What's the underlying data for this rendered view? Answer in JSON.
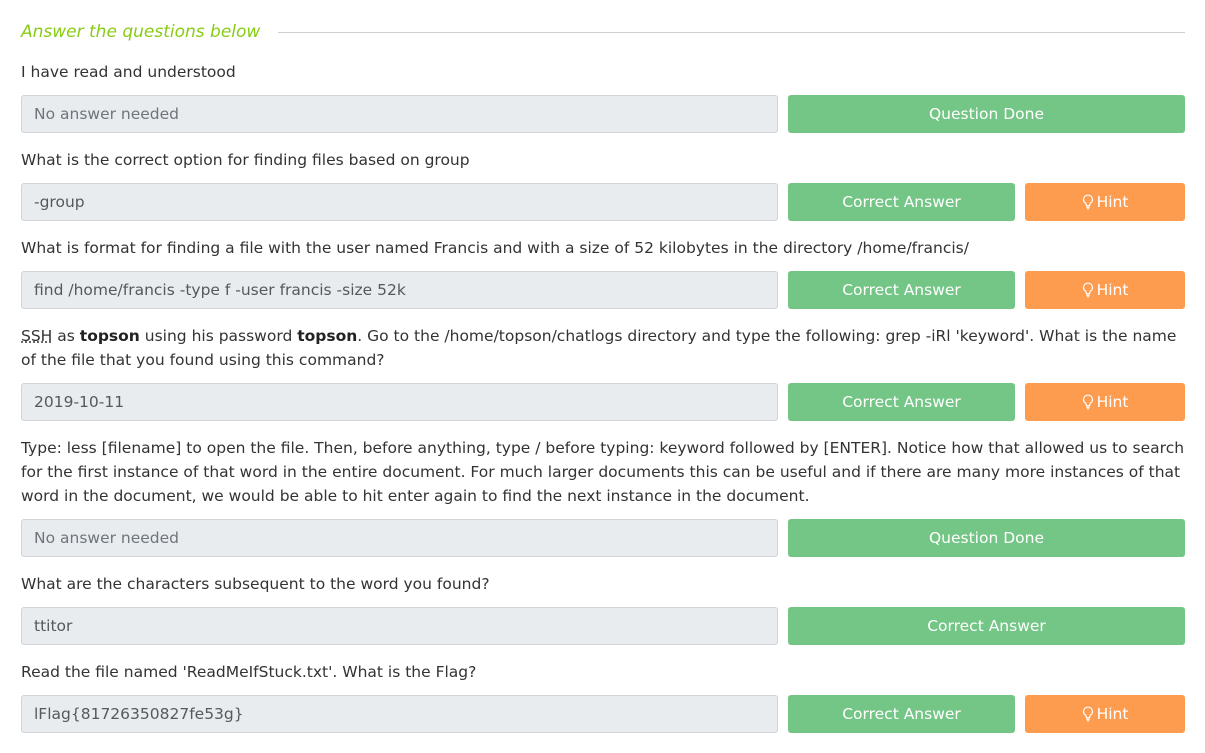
{
  "header": {
    "title": "Answer the questions below"
  },
  "questions": [
    {
      "text": "I have read and understood",
      "answer": "No answer needed",
      "button": "Question Done"
    },
    {
      "text": "What is the correct option for finding files based on group",
      "answer": "-group",
      "button": "Correct Answer",
      "hint": "Hint"
    },
    {
      "text": "What is format for finding a file with the user named Francis and with a size of 52 kilobytes in the directory /home/francis/",
      "answer": "find /home/francis -type f -user francis -size 52k",
      "button": "Correct Answer",
      "hint": "Hint"
    },
    {
      "text_parts": {
        "p1": "SSH",
        "p2": " as ",
        "p3": "topson",
        "p4": " using his password ",
        "p5": "topson",
        "p6": ". Go to the /home/topson/chatlogs directory and type the following: grep -iRl 'keyword'. What is the name of the file that you found using this command?"
      },
      "answer": "2019-10-11",
      "button": "Correct Answer",
      "hint": "Hint"
    },
    {
      "text": "Type: less [filename] to open the file. Then, before anything, type / before typing: keyword followed by [ENTER]. Notice how that allowed us to search for the first instance of that word in the entire document. For much larger documents this can be useful and if there are many more instances of that word in the document, we would be able to hit enter again to find the next instance in the document.",
      "answer": "No answer needed",
      "button": "Question Done"
    },
    {
      "text": "What are the characters subsequent to the word you found?",
      "answer": "ttitor",
      "button": "Correct Answer"
    },
    {
      "text": "Read the file named 'ReadMeIfStuck.txt'. What is the Flag?",
      "answer": "lFlag{81726350827fe53g}",
      "button": "Correct Answer",
      "hint": "Hint"
    }
  ],
  "colors": {
    "header_accent": "#88cc14",
    "button_green": "#74c686",
    "button_orange": "#fd9c4f",
    "input_bg": "#e9ecef"
  },
  "icons": {
    "hint": "lightbulb-icon"
  }
}
